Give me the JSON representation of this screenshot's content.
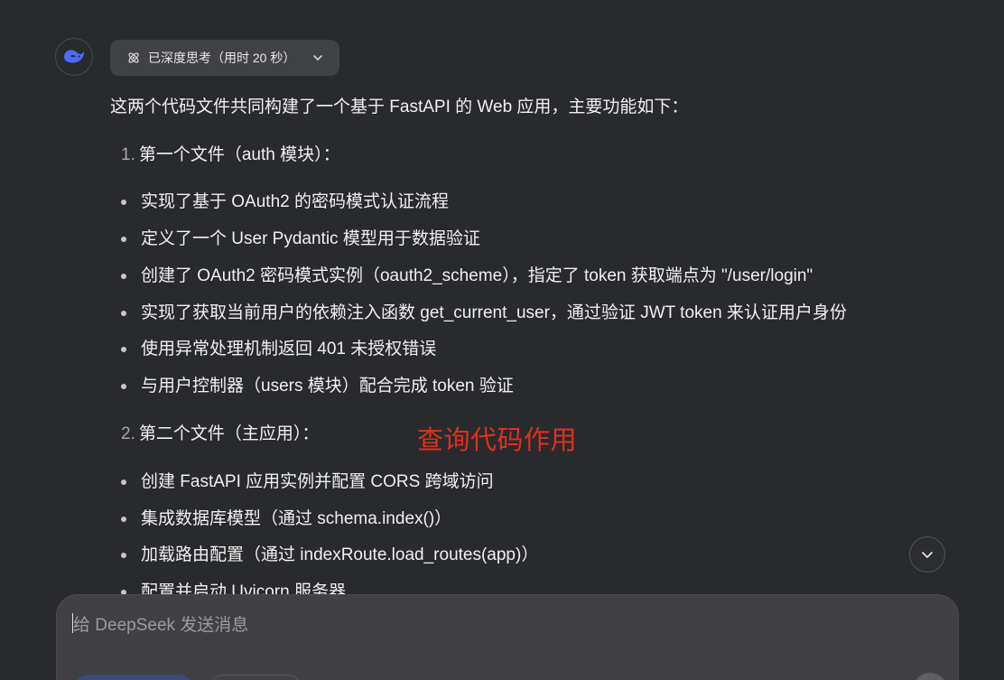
{
  "thinking": {
    "label": "已深度思考（用时 20 秒）"
  },
  "answer": {
    "intro": "这两个代码文件共同构建了一个基于 FastAPI 的 Web 应用，主要功能如下：",
    "sections": [
      {
        "number": "1.",
        "title": "第一个文件（auth 模块）：",
        "bullets": [
          "实现了基于 OAuth2 的密码模式认证流程",
          "定义了一个 User Pydantic 模型用于数据验证",
          "创建了 OAuth2 密码模式实例（oauth2_scheme），指定了 token 获取端点为 \"/user/login\"",
          "实现了获取当前用户的依赖注入函数 get_current_user，通过验证 JWT token 来认证用户身份",
          "使用异常处理机制返回 401 未授权错误",
          "与用户控制器（users 模块）配合完成 token 验证"
        ]
      },
      {
        "number": "2.",
        "title": "第二个文件（主应用）：",
        "bullets": [
          "创建 FastAPI 应用实例并配置 CORS 跨域访问",
          "集成数据库模型（通过 schema.index()）",
          "加载路由配置（通过 indexRoute.load_routes(app)）",
          "配置并启动 Uvicorn 服务器"
        ]
      }
    ]
  },
  "annotation": "查询代码作用",
  "composer": {
    "placeholder": "给 DeepSeek 发送消息"
  },
  "colors": {
    "background": "#292a2d",
    "annotation": "#e0301e",
    "chip": "#414246",
    "brand": "#4d6bfe"
  }
}
